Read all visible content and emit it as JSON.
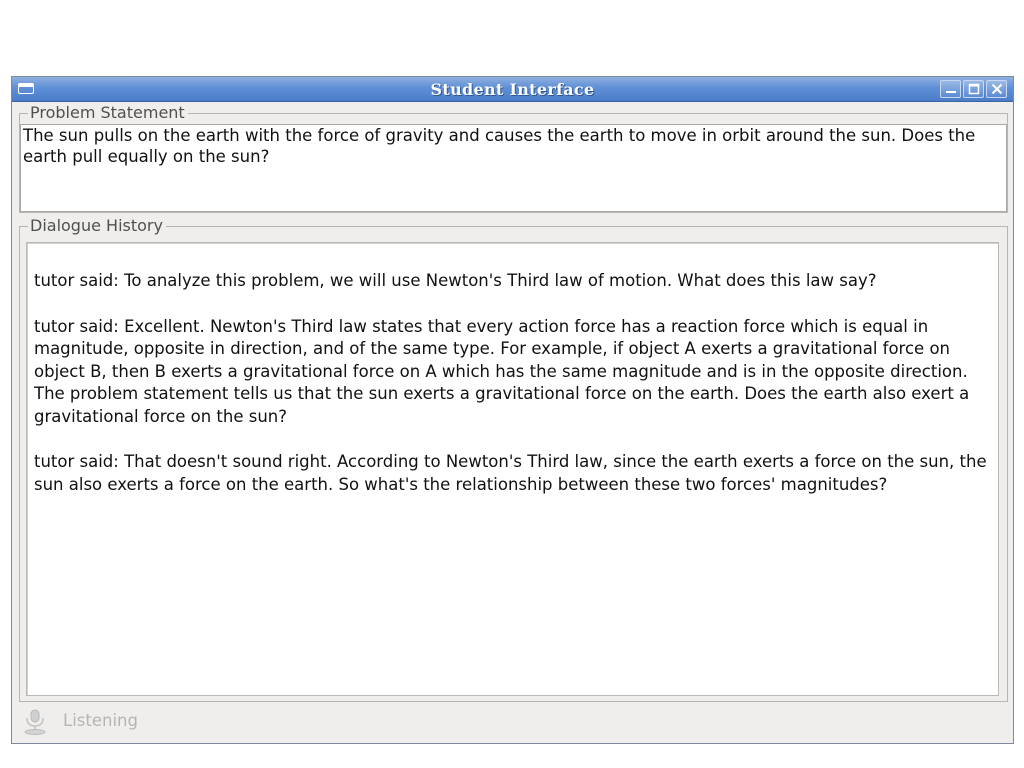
{
  "window": {
    "title": "Student Interface"
  },
  "problem": {
    "label": "Problem Statement",
    "text": "The sun pulls on the earth with the force of gravity and causes the earth to move in orbit around the sun. Does the earth pull equally on the sun?"
  },
  "dialogue": {
    "label": "Dialogue History",
    "messages": [
      "tutor said: To analyze this problem, we will use Newton's Third law of motion. What does this law say?",
      "tutor said: Excellent. Newton's Third law states that every action force has a reaction force which is equal in magnitude, opposite in direction, and of the same type. For example, if object A exerts a gravitational force on object B, then B exerts a gravitational force on A which has the same magnitude and is in the opposite direction. The problem statement tells us that the sun exerts a gravitational force on the earth. Does the earth also exert a gravitational force on the sun?",
      "tutor said: That doesn't sound right. According to Newton's Third law, since the earth exerts a force on the sun, the sun also exerts a force on the earth. So what's the relationship between these two forces' magnitudes?"
    ]
  },
  "status": {
    "text": "Listening",
    "icon": "microphone-icon"
  },
  "colors": {
    "titlebar": "#5f8fd6",
    "window_bg": "#efeeec",
    "status_text": "#b5b5b5"
  }
}
